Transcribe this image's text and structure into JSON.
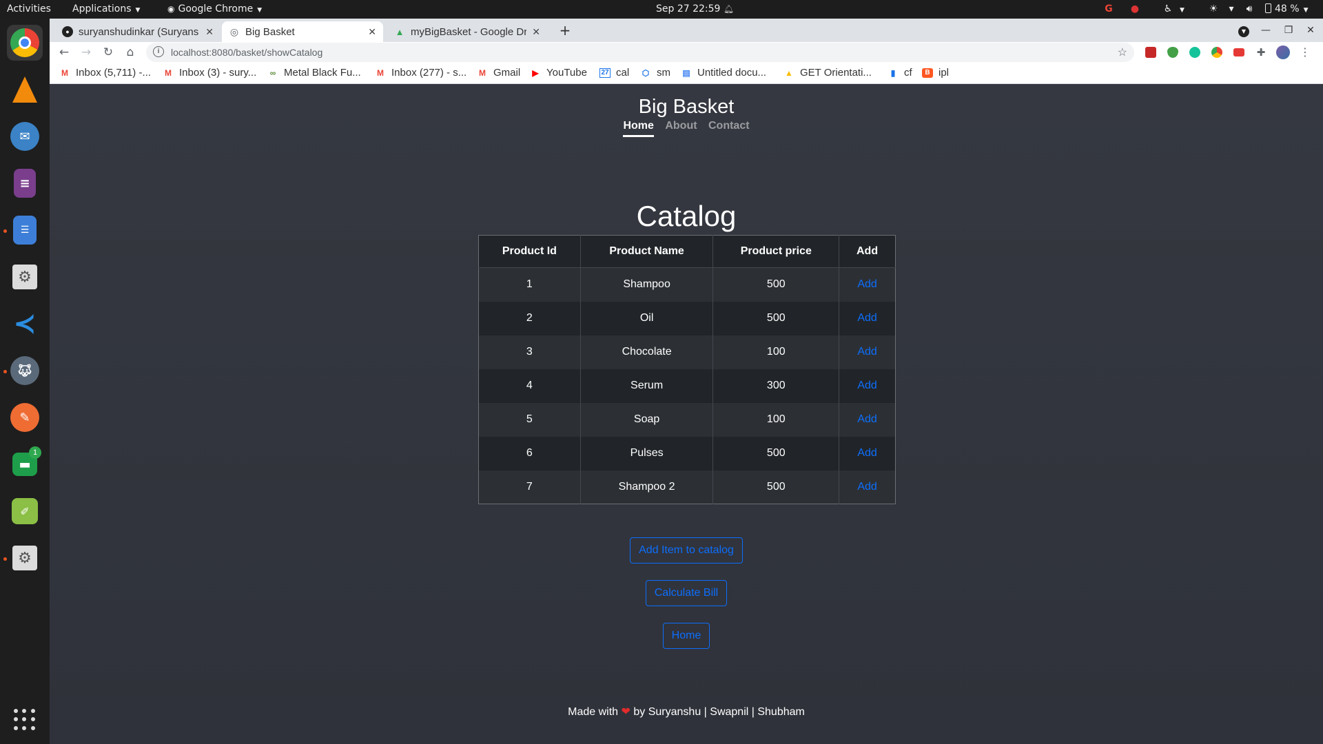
{
  "topbar": {
    "activities": "Activities",
    "applications": "Applications",
    "chrome_label": "Google Chrome",
    "clock": "Sep 27  22:59",
    "battery": "48 %"
  },
  "dock": {
    "apps": [
      "chrome",
      "vlc",
      "thunderbird",
      "text-editor",
      "files",
      "settings",
      "vscode",
      "gimp",
      "postman",
      "google-chat",
      "kolourpaint",
      "settings-2"
    ],
    "chat_badge": "1"
  },
  "browser": {
    "tabs": [
      {
        "title": "suryanshudinkar (Suryans",
        "icon": "github-icon"
      },
      {
        "title": "Big Basket",
        "icon": "globe-icon"
      },
      {
        "title": "myBigBasket - Google Dri",
        "icon": "drive-icon"
      }
    ],
    "url": "localhost:8080/basket/showCatalog",
    "bookmarks": [
      {
        "label": "Inbox (5,711) -...",
        "icon": "gmail-icon"
      },
      {
        "label": "Inbox (3) - sury...",
        "icon": "gmail-icon"
      },
      {
        "label": "Metal Black Fu...",
        "icon": "link-icon"
      },
      {
        "label": "Inbox (277) - s...",
        "icon": "gmail-icon"
      },
      {
        "label": "Gmail",
        "icon": "gmail-icon"
      },
      {
        "label": "YouTube",
        "icon": "youtube-icon"
      },
      {
        "label": "cal",
        "icon": "calendar-icon"
      },
      {
        "label": "sm",
        "icon": "cube-icon"
      },
      {
        "label": "Untitled docu...",
        "icon": "docs-icon"
      },
      {
        "label": "GET Orientati...",
        "icon": "drive-icon"
      },
      {
        "label": "cf",
        "icon": "bar-chart-icon"
      },
      {
        "label": "ipl",
        "icon": "blogger-icon"
      }
    ]
  },
  "page": {
    "brand": "Big Basket",
    "nav": [
      "Home",
      "About",
      "Contact"
    ],
    "title": "Catalog",
    "table": {
      "headers": [
        "Product Id",
        "Product Name",
        "Product price",
        "Add"
      ],
      "rows": [
        {
          "id": "1",
          "name": "Shampoo",
          "price": "500",
          "action": "Add"
        },
        {
          "id": "2",
          "name": "Oil",
          "price": "500",
          "action": "Add"
        },
        {
          "id": "3",
          "name": "Chocolate",
          "price": "100",
          "action": "Add"
        },
        {
          "id": "4",
          "name": "Serum",
          "price": "300",
          "action": "Add"
        },
        {
          "id": "5",
          "name": "Soap",
          "price": "100",
          "action": "Add"
        },
        {
          "id": "6",
          "name": "Pulses",
          "price": "500",
          "action": "Add"
        },
        {
          "id": "7",
          "name": "Shampoo 2",
          "price": "500",
          "action": "Add"
        }
      ]
    },
    "buttons": {
      "add_item": "Add Item to catalog",
      "calc_bill": "Calculate Bill",
      "home": "Home"
    },
    "footer": {
      "made_with": "Made with",
      "by": "by Suryanshu | Swapnil | Shubham"
    }
  },
  "colors": {
    "accent": "#0d6efd",
    "page_bg": "#333640",
    "heart": "#e32b2b"
  }
}
